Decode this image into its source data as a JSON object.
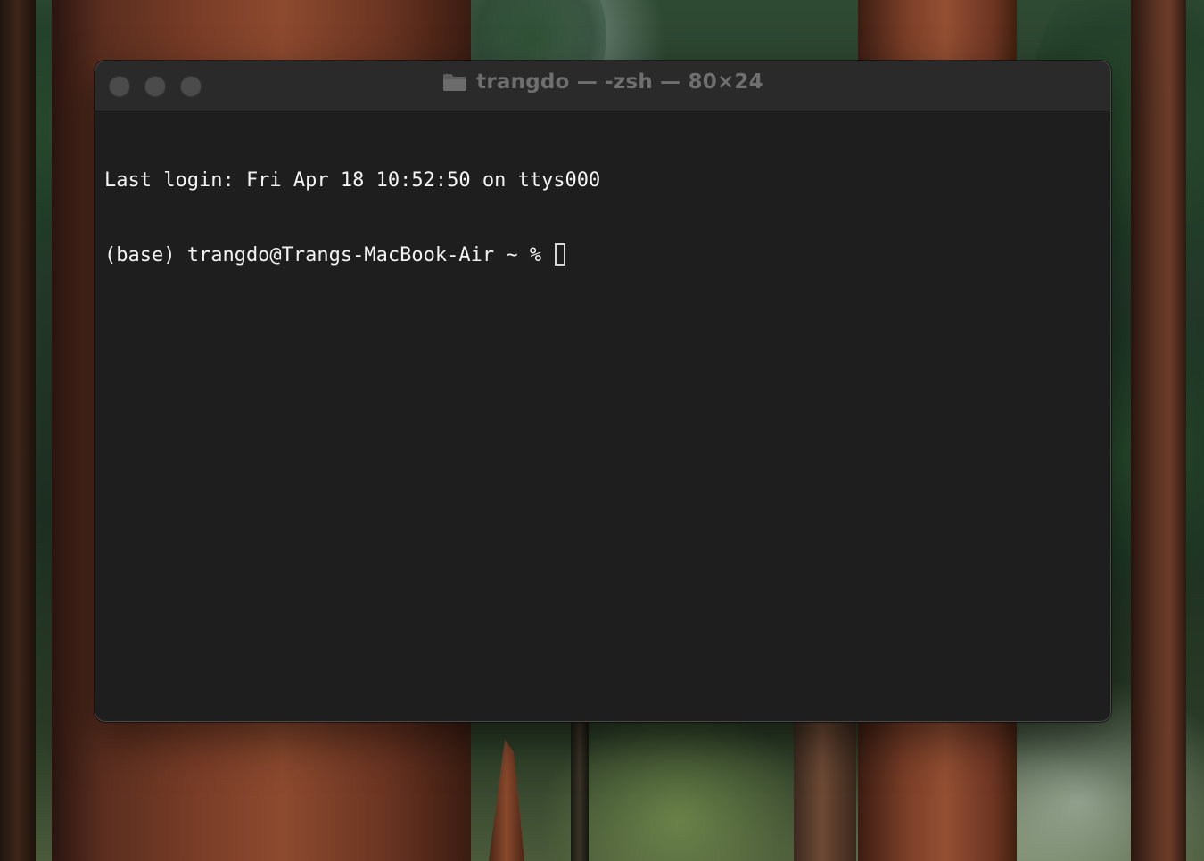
{
  "window": {
    "title": "trangdo — -zsh — 80×24",
    "folder_icon": "folder-icon",
    "controls": [
      "close-button",
      "minimize-button",
      "zoom-button"
    ]
  },
  "terminal": {
    "lines": [
      "Last login: Fri Apr 18 10:52:50 on ttys000",
      "(base) trangdo@Trangs-MacBook-Air ~ % "
    ],
    "cursor": "block-cursor"
  },
  "colors": {
    "terminal_background": "#1e1e1e",
    "terminal_text": "#f2f2f2",
    "titlebar_background": "#2a2a2a",
    "title_text": "#6f6f6f",
    "inactive_traffic_light": "#4b4b4b"
  }
}
